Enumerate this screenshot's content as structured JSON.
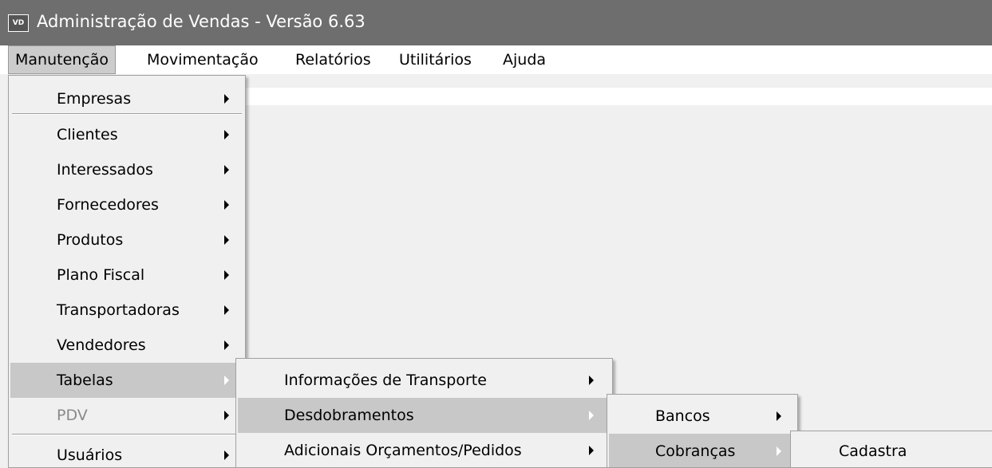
{
  "window": {
    "icon_text": "VD",
    "title": "Administração de Vendas - Versão 6.63"
  },
  "menubar": {
    "items": [
      {
        "label": "Manutenção"
      },
      {
        "label": "Movimentação"
      },
      {
        "label": "Relatórios"
      },
      {
        "label": "Utilitários"
      },
      {
        "label": "Ajuda"
      }
    ]
  },
  "menu_manutencao": {
    "items": [
      {
        "label": "Empresas"
      },
      {
        "label": "Clientes"
      },
      {
        "label": "Interessados"
      },
      {
        "label": "Fornecedores"
      },
      {
        "label": "Produtos"
      },
      {
        "label": "Plano Fiscal"
      },
      {
        "label": "Transportadoras"
      },
      {
        "label": "Vendedores"
      },
      {
        "label": "Tabelas"
      },
      {
        "label": "PDV"
      },
      {
        "label": "Usuários"
      }
    ]
  },
  "menu_tabelas": {
    "items": [
      {
        "label": "Informações de Transporte"
      },
      {
        "label": "Desdobramentos"
      },
      {
        "label": "Adicionais Orçamentos/Pedidos"
      }
    ]
  },
  "menu_desdobramentos": {
    "items": [
      {
        "label": "Bancos"
      },
      {
        "label": "Cobranças"
      }
    ]
  },
  "menu_cobrancas": {
    "items": [
      {
        "label": "Cadastra"
      }
    ]
  }
}
